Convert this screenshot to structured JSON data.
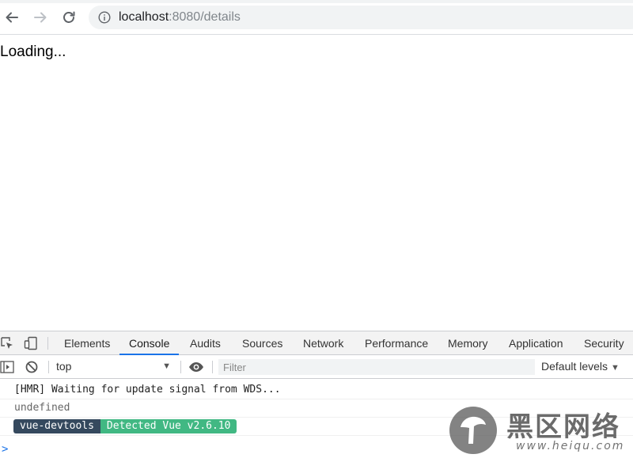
{
  "browser": {
    "url_host": "localhost",
    "url_rest": ":8080/details"
  },
  "page": {
    "loading_text": "Loading..."
  },
  "devtools": {
    "tabs": [
      {
        "label": "Elements"
      },
      {
        "label": "Console",
        "active": true
      },
      {
        "label": "Audits"
      },
      {
        "label": "Sources"
      },
      {
        "label": "Network"
      },
      {
        "label": "Performance"
      },
      {
        "label": "Memory"
      },
      {
        "label": "Application"
      },
      {
        "label": "Security"
      }
    ],
    "toolbar": {
      "context": "top",
      "filter_placeholder": "Filter",
      "levels": "Default levels"
    },
    "console": {
      "line1": "[HMR] Waiting for update signal from WDS...",
      "line2": "undefined",
      "badge_left": "vue-devtools",
      "badge_right": "Detected Vue v2.6.10",
      "prompt": ">"
    }
  },
  "watermark": {
    "title": "黑区网络",
    "url": "www.heiqu.com"
  },
  "colors": {
    "accent": "#1a73e8",
    "vue_dark": "#35495e",
    "vue_green": "#41b883"
  }
}
